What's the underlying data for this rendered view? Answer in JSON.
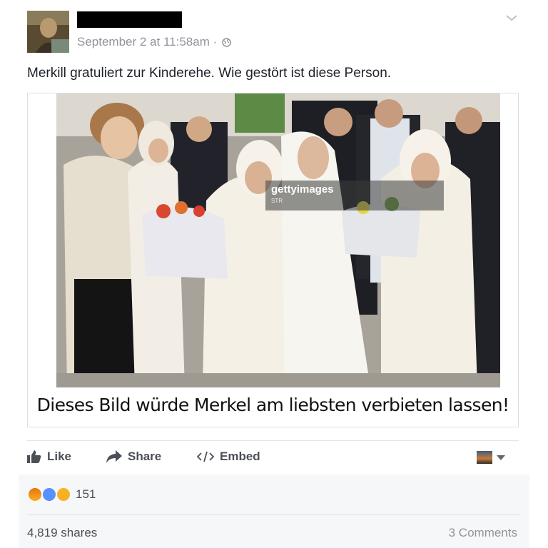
{
  "post": {
    "timestamp": "September 2 at 11:58am · ",
    "privacy_icon": "globe-icon",
    "text": "Merkill gratuliert zur Kinderehe. Wie gestört ist diese Person.",
    "options_icon": "chevron-down-icon"
  },
  "media": {
    "watermark": "gettyimages",
    "watermark_sub": "STR",
    "caption": "Dieses Bild würde Merkel am liebsten verbieten lassen!"
  },
  "actions": {
    "like_label": "Like",
    "share_label": "Share",
    "embed_label": "Embed",
    "like_icon": "thumbs-up-icon",
    "share_icon": "share-arrow-icon",
    "embed_icon": "code-icon"
  },
  "footer": {
    "reactions": [
      "angry",
      "like",
      "haha"
    ],
    "reaction_count": "151",
    "shares": "4,819 shares",
    "comments": "3 Comments"
  },
  "colors": {
    "text": "#1d2129",
    "meta": "#90949c",
    "action": "#4b4f56",
    "footer_bg": "#f6f7f9"
  }
}
